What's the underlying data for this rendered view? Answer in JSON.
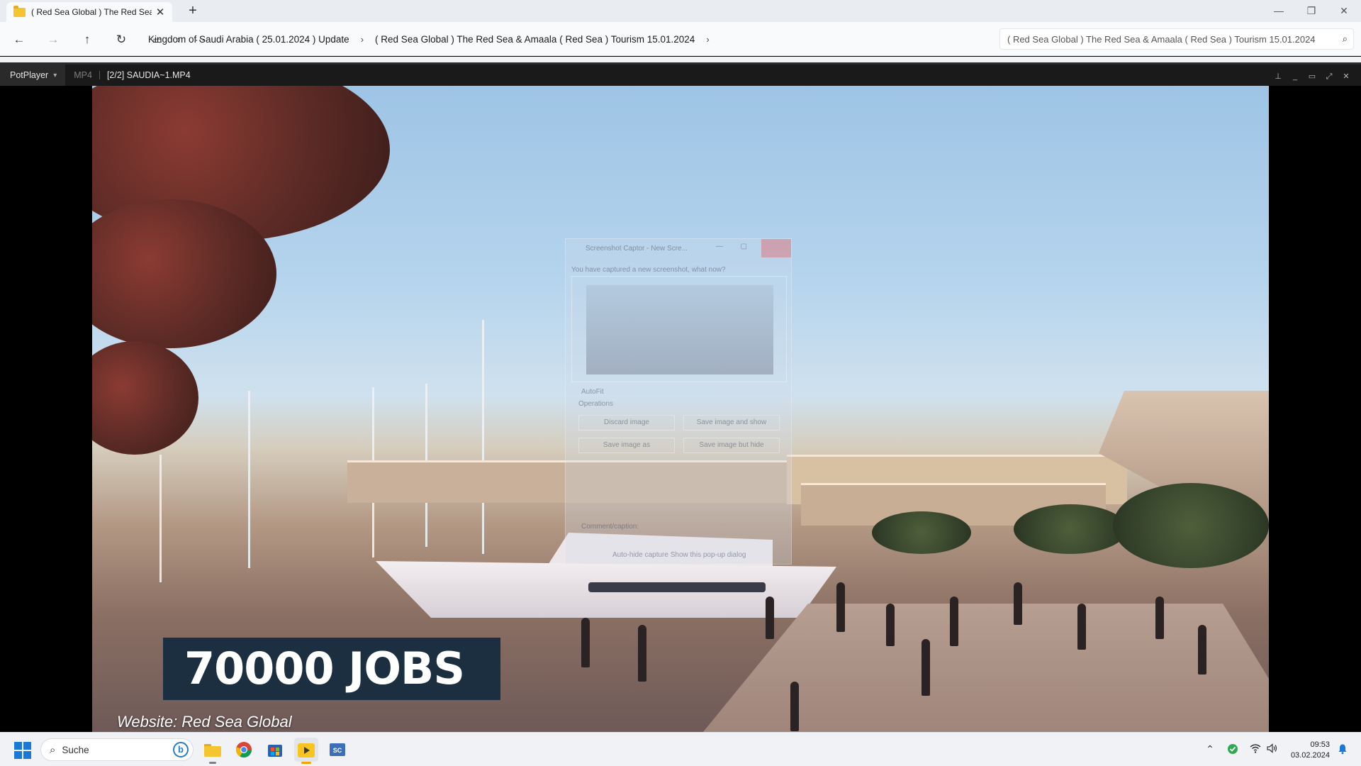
{
  "explorer": {
    "tab_title": "( Red Sea Global ) The Red Sea",
    "breadcrumbs": [
      "Kingdom of Saudi Arabia ( 25.01.2024 ) Update",
      "( Red Sea Global ) The Red Sea & Amaala ( Red Sea ) Tourism 15.01.2024"
    ],
    "search_text": "( Red Sea Global ) The Red Sea & Amaala ( Red Sea ) Tourism 15.01.2024"
  },
  "player": {
    "app_name": "PotPlayer",
    "format": "MP4",
    "file_name": "[2/2] SAUDIA~1.MP4"
  },
  "dialog_ghost": {
    "title": "Screenshot Captor - New Scre...",
    "question": "You have captured a new screenshot, what now?",
    "autofit": "AutoFit",
    "operations": "Operations",
    "buttons": [
      "Discard image",
      "Save image and show",
      "Save image as",
      "Save image but hide"
    ],
    "caption_label": "Comment/caption:",
    "bottom_text": "Auto-hide capture      Show this pop-up dialog"
  },
  "video_overlay": {
    "headline": "70000 JOBS",
    "source": "Website: Red Sea Global"
  },
  "taskbar": {
    "search_placeholder": "Suche",
    "time": "09:53",
    "date": "03.02.2024"
  },
  "colors": {
    "overlay_box": "#152c3f",
    "accent_blue": "#1b78d6"
  }
}
